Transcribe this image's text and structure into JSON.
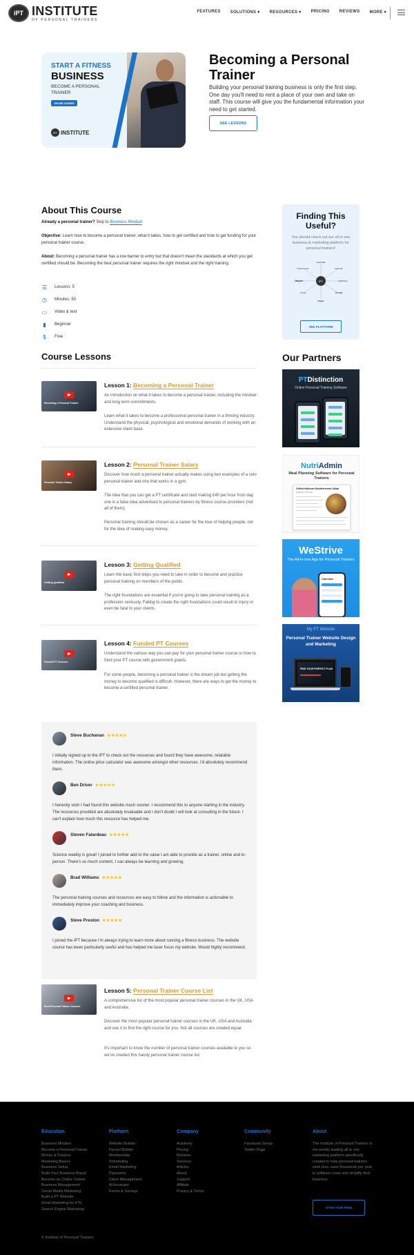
{
  "nav": {
    "logo_badge": "iPT",
    "logo_main": "INSTITUTE",
    "logo_sub": "OF PERSONAL TRAINERS",
    "menu": [
      "FEATURES",
      "SOLUTIONS ▾",
      "RESOURCES ▾",
      "PRICING",
      "REVIEWS",
      "MORE ▾"
    ],
    "hamburger_icon": "hamburger-icon"
  },
  "hero": {
    "card_line1": "START A FITNESS",
    "card_line2": "BUSINESS",
    "card_line3": "BECOME A PERSONAL TRAINER",
    "card_button": "ONLINE COURSE",
    "card_logo_badge": "iPT",
    "card_logo_text": "INSTITUTE",
    "title": "Becoming a Personal Trainer",
    "description": "Building your personal training business is only the first step. One day you'll need to rent a place of your own and take on staff. This course will give you the fundamental information your need to get started.",
    "button": "SEE LESSONS"
  },
  "about": {
    "title": "About This Course",
    "already_lead": "Already a personal trainer?",
    "already_skip": " Skip to ",
    "already_link": "Business Mindset",
    "objective_label": "Objective:",
    "objective_text": " Learn how to become a personal trainer, what it takes, how to get certified and how to get funding for your personal trainer course.",
    "about_label": "About:",
    "about_text": " Becoming a personal trainer has a low barrier to entry but that doesn't mean the standards at which you get certified should be. Becoming the best personal trainer requires the right mindset and the right training.",
    "facts": [
      {
        "icon": "list-icon",
        "glyph": "☰",
        "text": "Lessons: 5"
      },
      {
        "icon": "clock-icon",
        "glyph": "◷",
        "text": "Minutes: 50"
      },
      {
        "icon": "video-icon",
        "glyph": "▭",
        "text": "Video & text"
      },
      {
        "icon": "level-bars-icon",
        "glyph": "▮",
        "text": "Beginner"
      },
      {
        "icon": "dollar-icon",
        "glyph": "$",
        "text": "Free"
      }
    ]
  },
  "finding": {
    "title": "Finding This Useful?",
    "description": "You should check out our all in one business & marketing platform for personal trainers!",
    "diagram_center": "iPT",
    "diagram_labels": [
      "Teachable",
      "Calendly",
      "ClickFunnels",
      "Jasper",
      "mailchimp",
      "Acuity",
      "shopify",
      "Kajabi"
    ],
    "button": "SEE PLATFORM"
  },
  "lessons_title": "Course Lessons",
  "lessons": [
    {
      "prefix": "Lesson 1: ",
      "title": "Becoming a Personal Trainer",
      "thumb_caption": "Becoming a Personal Trainer",
      "paras": [
        "An introduction on what it takes to become a personal  trainer, including the mindset and long  term commitments.",
        "Learn what it takes to become a professional personal trainer in a thriving industry.  Understand the physical, psychological and emotional demands of working with an extensive client base."
      ]
    },
    {
      "prefix": "Lesson 2: ",
      "title": "Personal Trainer Salary",
      "thumb_caption": "Personal Trainer Salary",
      "paras": [
        "Discover how much a personal trainer actually makes using two examples of a solo personal trainer and one that works in a gym.",
        "The idea that you can get a PT certificate and start making £40 per hour from day one is a false idea advertised to personal trainers by fitness course providers (not all of them).",
        "Personal training should be chosen as a career for the love of helping people, not for the idea of making easy money."
      ]
    },
    {
      "prefix": "Lesson 3: ",
      "title": "Getting Qualified",
      "thumb_caption": "Getting Qualified",
      "paras": [
        "Learn the basic first steps you need to take in order to become and practice personal training  on members of the public.",
        "The right foundations are essential if you're going to take personal training as a profession seriously. Failing to create the right foundations could result in injury or even be fatal to your clients."
      ]
    },
    {
      "prefix": "Lesson 4: ",
      "title": "Funded PT Courses",
      "thumb_caption": "Funded PT Courses",
      "paras": [
        "Understand the various way you can pay for your   personal trainer course or how to fund your PT   course with government grants.",
        "For some people, becoming a personal trainer is the dream job but getting the money to become qualified is difficult. However, there are ways to get the money to become a certified personal trainer."
      ]
    },
    {
      "prefix": "Lesson 5: ",
      "title": "Personal Trainer Course List",
      "thumb_caption": "Best Personal Trainer Courses",
      "paras": [
        "A comprehensive list of the most popular  personal   trainer courses in the UK, USA and  Australia.",
        "Discover the most popular personal trainer courses in the UK, USA and Australia and use it to find the right course for you. Not all courses are created equal.",
        "It's important to know the number of personal trainer courses available to you so we've created this handy personal trainer course list."
      ]
    }
  ],
  "partners": {
    "title": "Our Partners",
    "p1": {
      "brand_a": "PT",
      "brand_b": "Distinction",
      "sub": "Online Personal Training Software"
    },
    "p2": {
      "brand_a": "Nutri",
      "brand_b": "Admin",
      "sub": "Meal Planning Software for Personal Trainers",
      "sheet_title": "Grilled Halloumi Mediterranean Salad",
      "sheet_sub": "Calories: 420 kcal"
    },
    "p3": {
      "brand": "WeStrive",
      "sub": "The All-in-one App for Personal Trainers",
      "phone_title": "Calendar"
    },
    "p4": {
      "top": "My PT Website",
      "title": "Personal Trainer Website Design and Marketing",
      "screen_text": "FIND YOUR PERFECT PLAN"
    }
  },
  "testimonials": {
    "stars": "★★★★★",
    "items": [
      {
        "name": "Steve Buchanan",
        "text": "I initially signed up to the iPT to check out the resources and found they have awesome, relatable information. The online price calculator was awesome amongst other resources. I'd absolutely recommend them."
      },
      {
        "name": "Ben Driver",
        "text": "I honestly wish I had found this website much sooner. I recommend this to anyone starting in the industry. The resources provided are absolutely invaluable and I don't doubt I will look at consulting in the future. I can't explain how much this resource has helped me."
      },
      {
        "name": "Steven Falardeau",
        "text": "Science weekly is great! I joined to further add to the value I am able to provide as a trainer, online and in-person. There's so much content, I can always be learning and growing."
      },
      {
        "name": "Brad Williams",
        "text": "The personal training courses and resources are easy to follow and the information is actionable to immediately improve your coaching and business."
      },
      {
        "name": "Steve Preston",
        "text": "I joined the iPT because I'm always trying to learn more about running a fitness business. The website course has been particularly useful and has helped me laser focus my website. Would highly recommend."
      }
    ]
  },
  "footer": {
    "education": {
      "head": "Education",
      "links": [
        "Business Mindset",
        "Become a Personal Trainer",
        "Money & Finance",
        "Marketing Basics",
        "Business Setup",
        "Build Your Business Brand",
        "Become an Online Trainer",
        "Business Management",
        "Social Media Marketing",
        "Build a PT Website",
        "Email Marketing for PTs",
        "Search Engine Marketing"
      ]
    },
    "platform": {
      "head": "Platform",
      "links": [
        "Website Builder",
        "Funnel Builder",
        "Membership",
        "Scheduling",
        "Email Marketing",
        "Payments",
        "Client Management",
        "AI Assistant",
        "Forms & Surveys"
      ]
    },
    "company": {
      "head": "Company",
      "links": [
        "Academy",
        "Pricing",
        "Reviews",
        "Services",
        "Articles",
        "About",
        "Support",
        "Affiliate",
        "Privacy & Terms"
      ]
    },
    "community": {
      "head": "Community",
      "links": [
        "Facebook Group",
        "Twitter Page"
      ]
    },
    "about": {
      "head": "About",
      "text": "The Institute of Personal Trainers is the worlds leading all in one marketing platform specifically created to help personal trainers work less, save thousands per year in software costs and simplify their business."
    },
    "button": "START FOR FREE",
    "copyright": "© Institute of Personal Trainers"
  },
  "colors": {
    "accent": "#1a73c9",
    "lesson_title": "#d89a2b",
    "footer_bg": "#000000",
    "finding_bg": "#e7f2fd"
  }
}
